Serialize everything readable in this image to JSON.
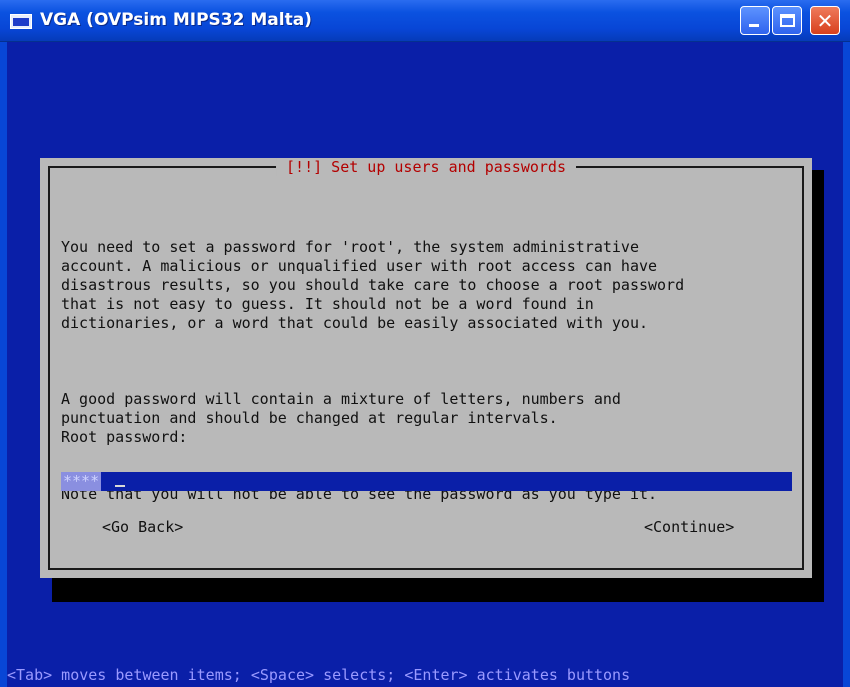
{
  "window": {
    "title": "VGA (OVPsim MIPS32 Malta)",
    "icons": {
      "app": "vga-window-icon",
      "minimize": "minimize-icon",
      "maximize": "maximize-icon",
      "close": "close-icon"
    }
  },
  "dialog": {
    "title": "[!!] Set up users and passwords",
    "paragraphs": [
      "You need to set a password for 'root', the system administrative\naccount. A malicious or unqualified user with root access can have\ndisastrous results, so you should take care to choose a root password\nthat is not easy to guess. It should not be a word found in\ndictionaries, or a word that could be easily associated with you.",
      "A good password will contain a mixture of letters, numbers and\npunctuation and should be changed at regular intervals.",
      "Note that you will not be able to see the password as you type it."
    ],
    "password_label": "Root password:",
    "password_value": "****",
    "buttons": {
      "back": "<Go Back>",
      "continue": "<Continue>"
    }
  },
  "status_bar": "<Tab> moves between items; <Space> selects; <Enter> activates buttons",
  "colors": {
    "background": "#0a1fa8",
    "dialog_bg": "#b9b9b9",
    "title_text": "#b30000",
    "input_bg": "#0a1fa8",
    "status_text": "#9a9aff"
  }
}
